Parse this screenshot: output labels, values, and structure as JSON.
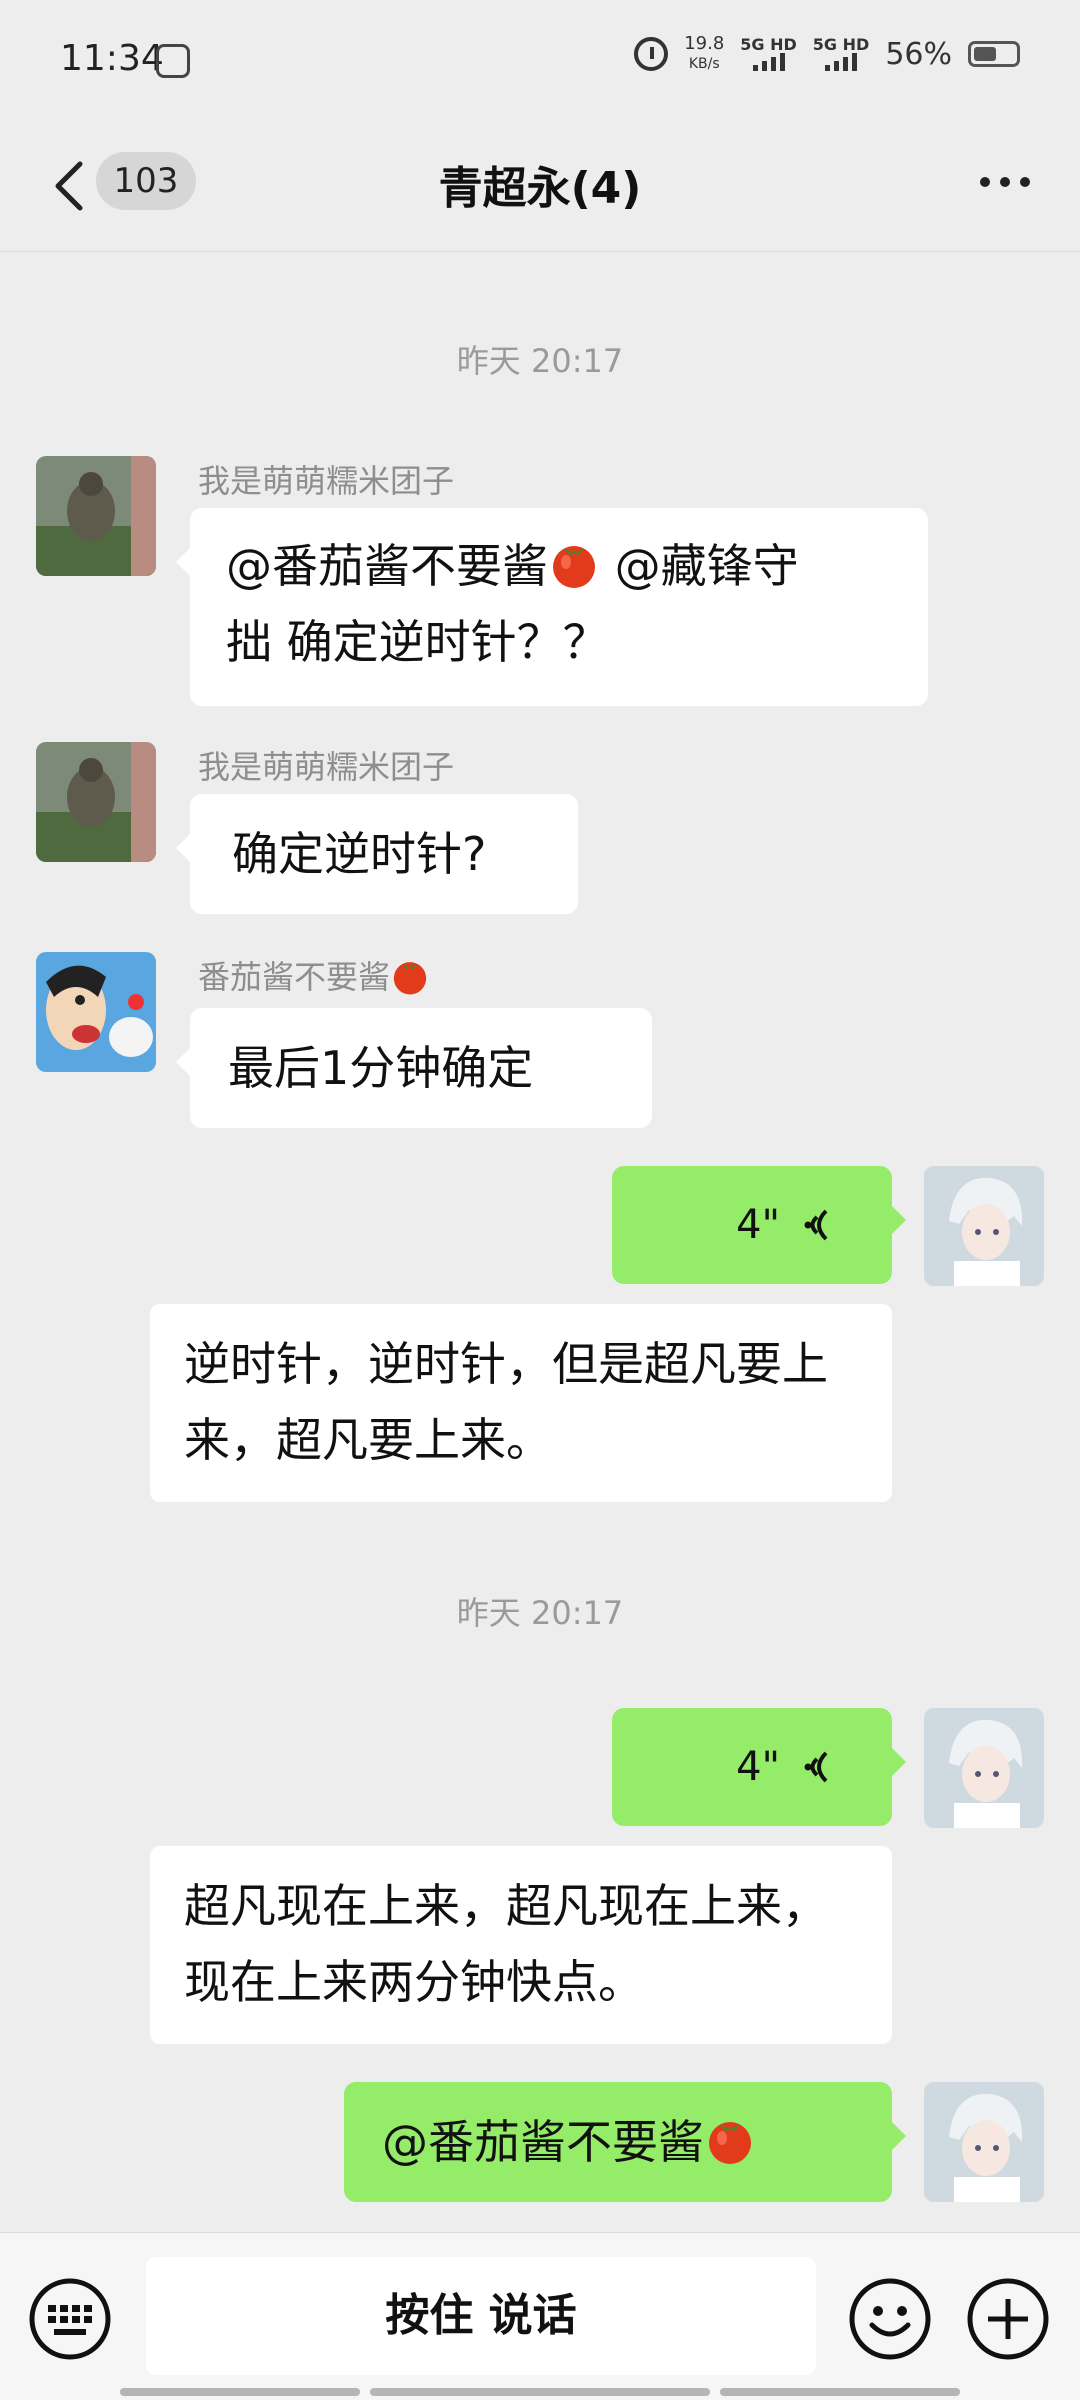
{
  "status_bar": {
    "time": "11:34",
    "speed_value": "19.8",
    "speed_unit": "KB/s",
    "network1": "5G HD",
    "network2": "5G HD",
    "battery": "56%"
  },
  "header": {
    "unread_count": "103",
    "title": "青超永(4)"
  },
  "messages": {
    "time1": "昨天 20:17",
    "m1_sender": "我是萌萌糯米团子",
    "m1_text_a": "@番茄酱不要酱",
    "m1_text_b": " @藏锋守",
    "m1_text_c": "拙  确定逆时针？？",
    "m2_sender": "我是萌萌糯米团子",
    "m2_text": "确定逆时针?",
    "m3_sender": "番茄酱不要酱",
    "m3_text": "最后1分钟确定",
    "m4_duration": "4\"",
    "m4_transcript": "逆时针，逆时针，但是超凡要上来，超凡要上来。",
    "time2": "昨天 20:17",
    "m5_duration": "4\"",
    "m5_transcript": "超凡现在上来，超凡现在上来，现在上来两分钟快点。",
    "m6_text": "@番茄酱不要酱"
  },
  "input_bar": {
    "hold_to_talk": "按住 说话"
  },
  "colors": {
    "background": "#ededed",
    "sent_bubble": "#95ec69",
    "received_bubble": "#ffffff"
  }
}
